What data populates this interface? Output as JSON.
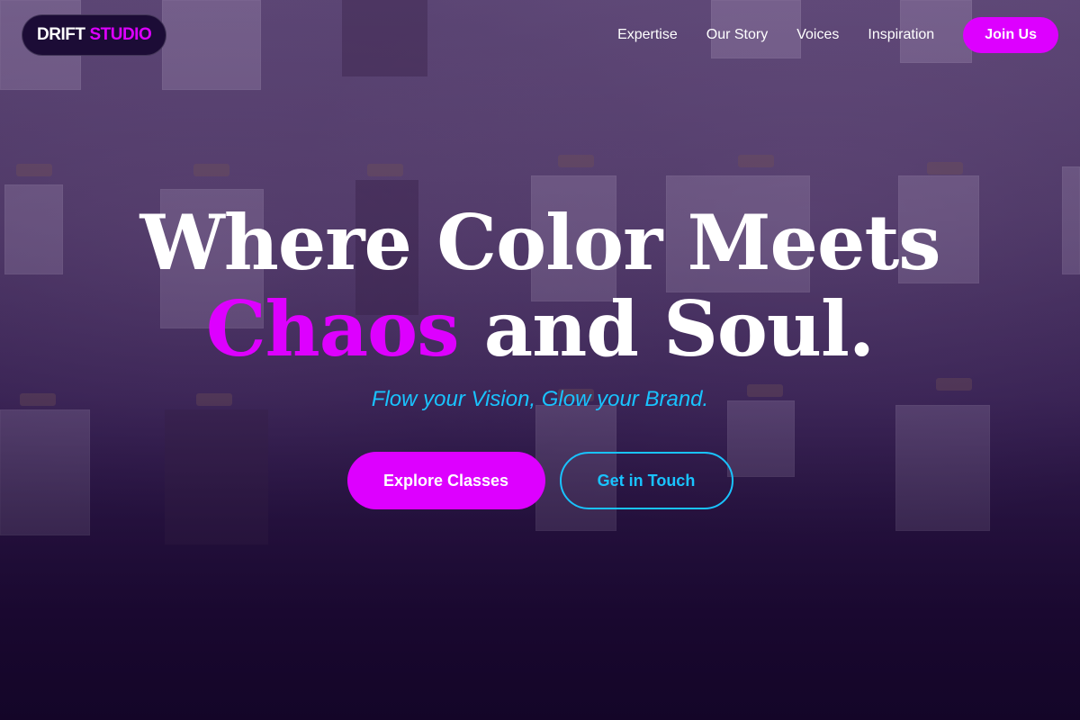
{
  "brand": {
    "name_part1": "DRIFT",
    "name_part2": "STUDIO"
  },
  "nav": {
    "items": [
      {
        "label": "Expertise"
      },
      {
        "label": "Our Story"
      },
      {
        "label": "Voices"
      },
      {
        "label": "Inspiration"
      }
    ],
    "cta_label": "Join Us"
  },
  "hero": {
    "headline_line1": "Where Color Meets",
    "headline_accent": "Chaos",
    "headline_rest": " and Soul.",
    "tagline": "Flow your Vision, Glow your Brand.",
    "primary_cta": "Explore Classes",
    "secondary_cta": "Get in Touch"
  },
  "colors": {
    "accent": "#dd00ff",
    "secondary": "#19c3ff",
    "background": "#1e0c34"
  }
}
